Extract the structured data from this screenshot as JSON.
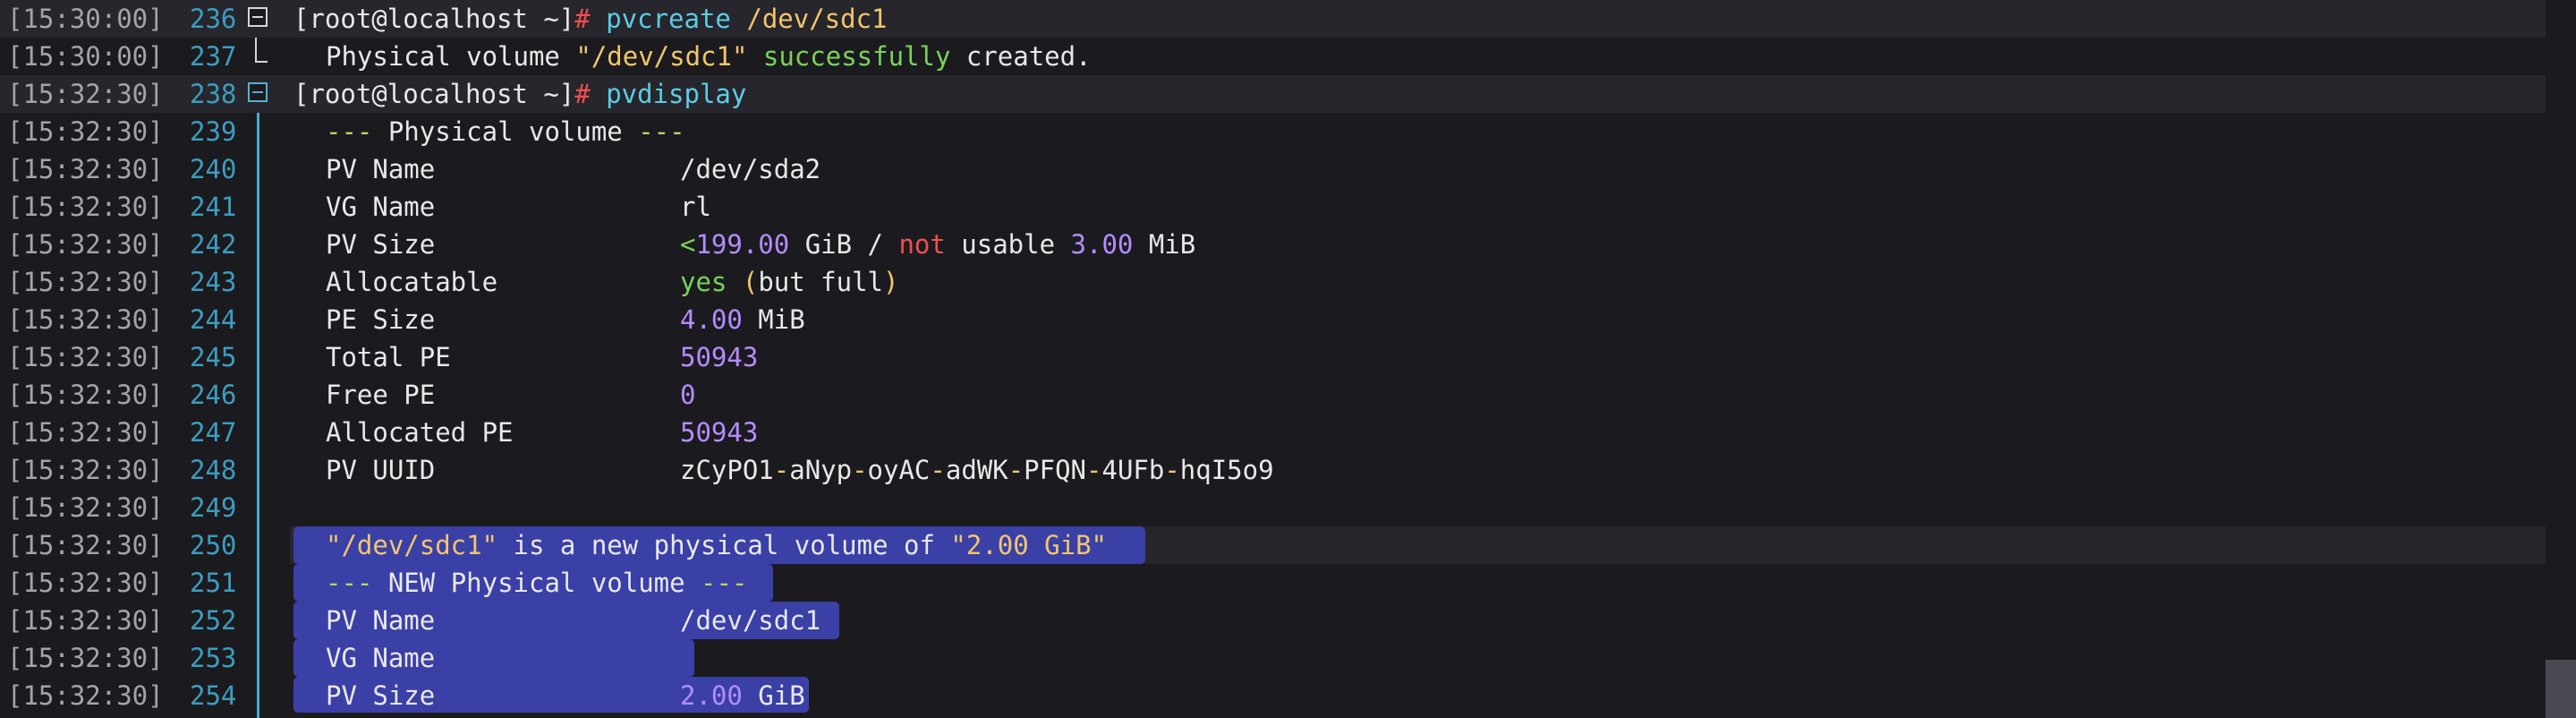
{
  "terminal": {
    "prompt": "[root@localhost ~]",
    "prompt_hash": "#",
    "lines": [
      {
        "ts": "[15:30:00]",
        "ln": "236"
      },
      {
        "ts": "[15:30:00]",
        "ln": "237"
      },
      {
        "ts": "[15:32:30]",
        "ln": "238"
      },
      {
        "ts": "[15:32:30]",
        "ln": "239"
      },
      {
        "ts": "[15:32:30]",
        "ln": "240"
      },
      {
        "ts": "[15:32:30]",
        "ln": "241"
      },
      {
        "ts": "[15:32:30]",
        "ln": "242"
      },
      {
        "ts": "[15:32:30]",
        "ln": "243"
      },
      {
        "ts": "[15:32:30]",
        "ln": "244"
      },
      {
        "ts": "[15:32:30]",
        "ln": "245"
      },
      {
        "ts": "[15:32:30]",
        "ln": "246"
      },
      {
        "ts": "[15:32:30]",
        "ln": "247"
      },
      {
        "ts": "[15:32:30]",
        "ln": "248"
      },
      {
        "ts": "[15:32:30]",
        "ln": "249"
      },
      {
        "ts": "[15:32:30]",
        "ln": "250"
      },
      {
        "ts": "[15:32:30]",
        "ln": "251"
      },
      {
        "ts": "[15:32:30]",
        "ln": "252"
      },
      {
        "ts": "[15:32:30]",
        "ln": "253"
      },
      {
        "ts": "[15:32:30]",
        "ln": "254"
      }
    ],
    "cmd1": {
      "command": "pvcreate",
      "arg": "/dev/sdc1"
    },
    "out1": {
      "pre": "Physical volume ",
      "quoted": "\"/dev/sdc1\"",
      "ok": "successfully",
      "post": " created."
    },
    "cmd2": {
      "command": "pvdisplay"
    },
    "pv1": {
      "header_dash1": "---",
      "header_text": " Physical volume ",
      "header_dash2": "---",
      "pv_name_label": "PV Name",
      "pv_name": "/dev/sda2",
      "vg_name_label": "VG Name",
      "vg_name": "rl",
      "pv_size_label": "PV Size",
      "pv_size_lt": "<",
      "pv_size_num": "199.00",
      "pv_size_unit": " GiB / ",
      "pv_size_not": "not",
      "pv_size_usable": " usable ",
      "pv_size_num2": "3.00",
      "pv_size_unit2": " MiB",
      "alloc_label": "Allocatable",
      "alloc_yes": "yes",
      "alloc_open": " (",
      "alloc_text": "but full",
      "alloc_close": ")",
      "pe_size_label": "PE Size",
      "pe_size_num": "4.00",
      "pe_size_unit": " MiB",
      "total_pe_label": "Total PE",
      "total_pe": "50943",
      "free_pe_label": "Free PE",
      "free_pe": "0",
      "allocated_pe_label": "Allocated PE",
      "allocated_pe": "50943",
      "uuid_label": "PV UUID",
      "uuid_parts": [
        "zCyPO1",
        "aNyp",
        "oyAC",
        "adWK",
        "PFQN",
        "4UFb",
        "hqI5o9"
      ],
      "uuid_sep": "-"
    },
    "new_msg": {
      "quoted": "\"/dev/sdc1\"",
      "middle": " is a new physical volume of ",
      "size": "\"2.00 GiB\""
    },
    "pv2": {
      "header_dash1": "---",
      "header_text": " NEW Physical volume ",
      "header_dash2": "---",
      "pv_name_label": "PV Name",
      "pv_name": "/dev/sdc1",
      "vg_name_label": "VG Name",
      "vg_name": "",
      "pv_size_label": "PV Size",
      "pv_size_num": "2.00",
      "pv_size_unit": " GiB"
    }
  }
}
